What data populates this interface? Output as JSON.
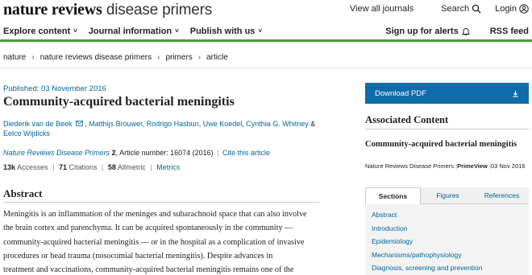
{
  "header": {
    "brand_bold": "nature reviews",
    "brand_light": "disease primers",
    "links": {
      "journals": "View all journals",
      "search": "Search",
      "login": "Login"
    },
    "icons": {
      "search": "search-icon",
      "login": "user-icon"
    }
  },
  "nav": {
    "left": [
      "Explore content",
      "Journal information",
      "Publish with us"
    ],
    "alerts": "Sign up for alerts",
    "rss": "RSS feed",
    "accent_color": "#4d9a3c"
  },
  "breadcrumb": [
    "nature",
    "nature reviews disease primers",
    "primers",
    "article"
  ],
  "article": {
    "published": "Published: 03 November 2016",
    "title": "Community-acquired bacterial meningitis",
    "authors": [
      "Diederik van de Beek",
      "Matthijs Brouwer",
      "Rodrigo Hasbun",
      "Uwe Koedel",
      "Cynthia G. Whitney",
      "Eelco Wijdicks"
    ],
    "amp": "&",
    "citation": {
      "journal": "Nature Reviews Disease Primers",
      "volume": "2",
      "article_number": ", Article number: 16074 (2016)",
      "cite_link": "Cite this article"
    },
    "metrics": {
      "accesses_value": "13k",
      "accesses_label": "Accesses",
      "citations_value": "71",
      "citations_label": "Citations",
      "altmetric_value": "58",
      "altmetric_label": "Altmetric",
      "metrics_link": "Metrics"
    },
    "abstract_heading": "Abstract",
    "abstract_lines": [
      "Meningitis is an inflammation of the meninges and subarachnoid space that can also involve",
      "the brain cortex and parenchyma. It can be acquired spontaneously in the community —",
      "community-acquired bacterial meningitis — or in the hospital as a complication of invasive",
      "procedures or head trauma (nosocomial bacterial meningitis). Despite advances in",
      "treatment and vaccinations, community-acquired bacterial meningitis remains one of the"
    ]
  },
  "sidebar": {
    "download_label": "Download PDF",
    "download_color": "#0f6ca8",
    "associated_heading": "Associated Content",
    "assoc_title": "Community-acquired bacterial meningitis",
    "assoc_journal": "Nature Reviews Disease Primers",
    "assoc_type": "PrimeView",
    "assoc_date": "03 Nov 2016",
    "tabs": [
      "Sections",
      "Figures",
      "References"
    ],
    "toc": [
      "Abstract",
      "Introduction",
      "Epidemiology",
      "Mechanisms/pathophysiology",
      "Diagnosis, screening and prevention"
    ]
  }
}
